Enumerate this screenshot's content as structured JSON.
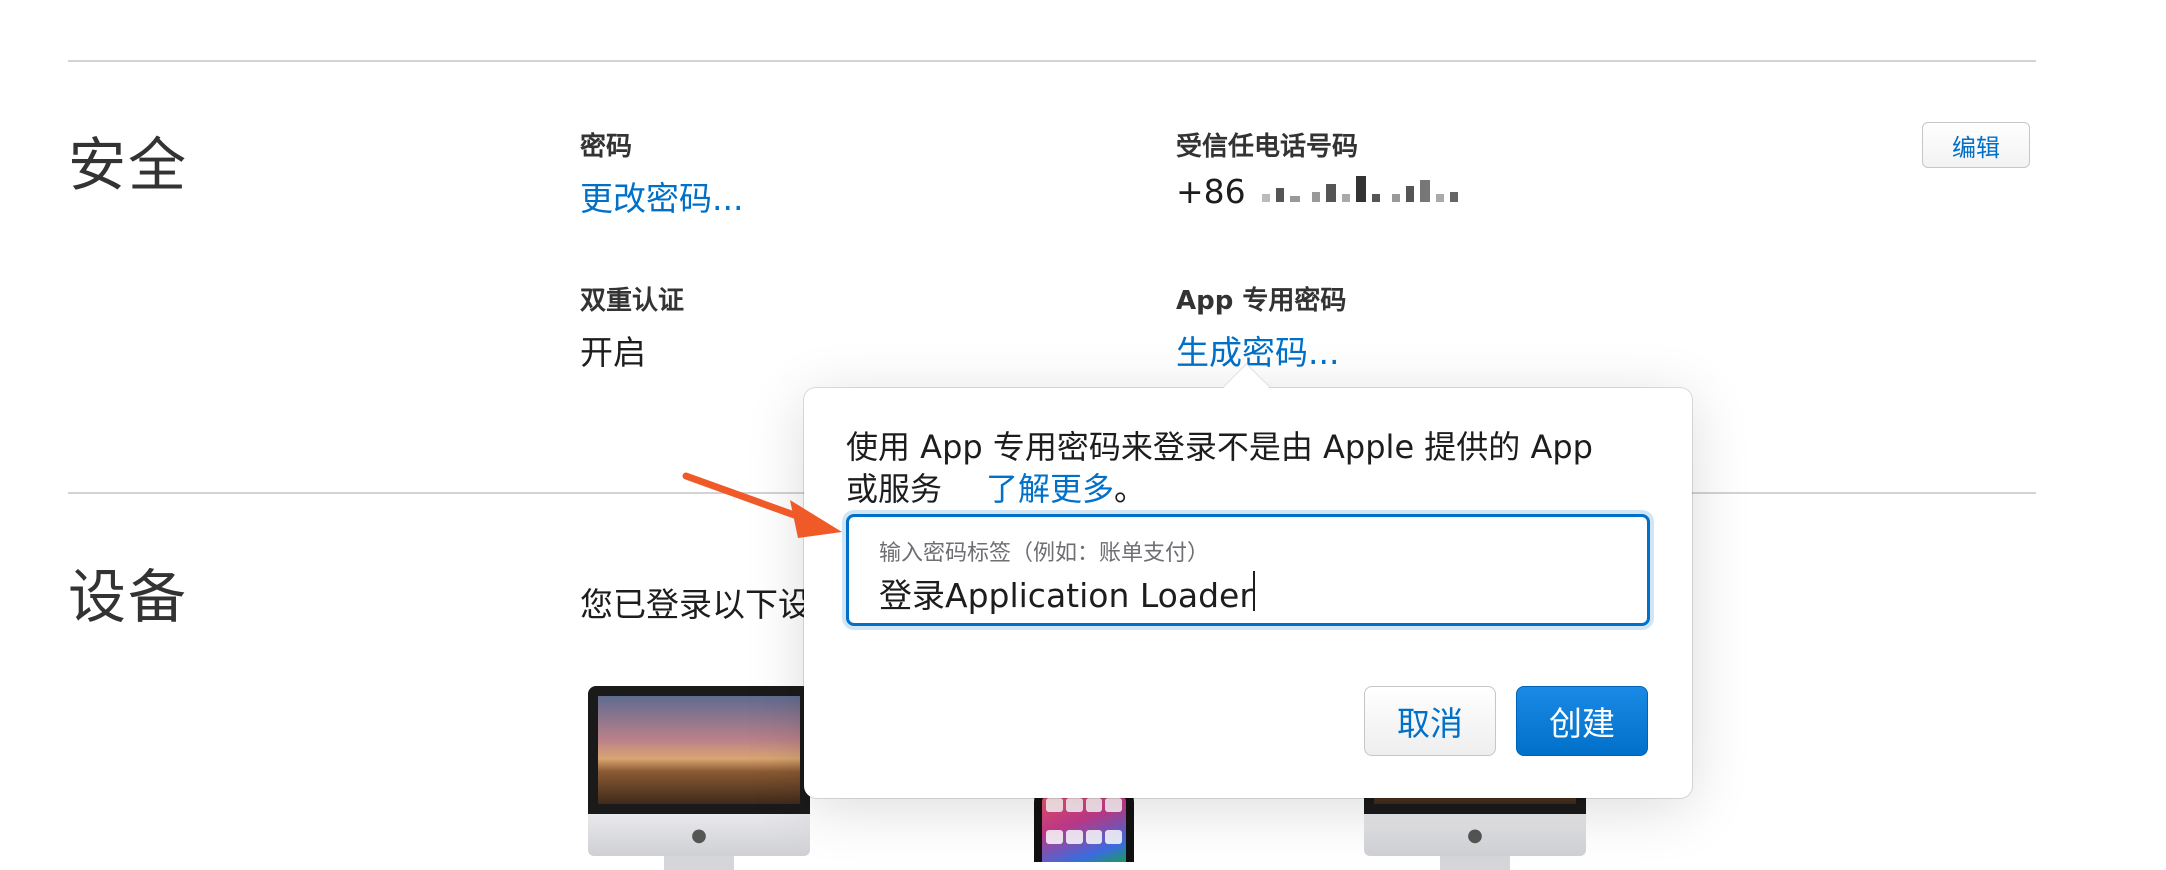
{
  "security": {
    "title": "安全",
    "password_label": "密码",
    "password_link": "更改密码...",
    "phone_label": "受信任电话号码",
    "phone_prefix": "+86",
    "edit_button": "编辑",
    "twofa_label": "双重认证",
    "twofa_value": "开启",
    "apppw_label": "App 专用密码",
    "apppw_link": "生成密码..."
  },
  "devices": {
    "title": "设备",
    "intro_partial": "您已登录以下设"
  },
  "popover": {
    "description": "使用 App 专用密码来登录不是由 Apple 提供的 App 或服务。",
    "learn_more": "了解更多",
    "learn_more_suffix": "。",
    "input_label": "输入密码标签（例如：账单支付）",
    "input_value": "登录Application Loader",
    "cancel_button": "取消",
    "create_button": "创建"
  },
  "colors": {
    "link": "#0070c9",
    "accent_button": "#0070c9",
    "annotation_arrow": "#f05a28"
  },
  "icons": {
    "annotation": "red-arrow-icon",
    "apple_logo": "apple-logo-icon"
  }
}
